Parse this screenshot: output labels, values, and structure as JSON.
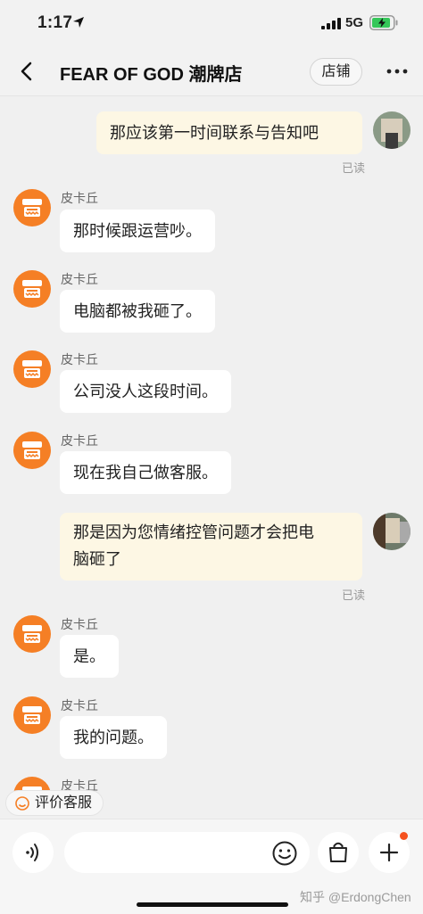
{
  "status": {
    "time": "1:17",
    "network": "5G"
  },
  "nav": {
    "title": "FEAR OF GOD 潮牌店",
    "shop_label": "店铺"
  },
  "messages": [
    {
      "dir": "out",
      "text": "那应该第一时间联系与告知吧",
      "read": "已读"
    },
    {
      "dir": "in",
      "sender": "皮卡丘",
      "text": "那时候跟运营吵。"
    },
    {
      "dir": "in",
      "sender": "皮卡丘",
      "text": "电脑都被我砸了。"
    },
    {
      "dir": "in",
      "sender": "皮卡丘",
      "text": "公司没人这段时间。"
    },
    {
      "dir": "in",
      "sender": "皮卡丘",
      "text": "现在我自己做客服。"
    },
    {
      "dir": "out",
      "text_line1": "那是因为您情绪控管问题才会把电",
      "text_line2": "脑砸了",
      "read": "已读"
    },
    {
      "dir": "in",
      "sender": "皮卡丘",
      "text": "是。"
    },
    {
      "dir": "in",
      "sender": "皮卡丘",
      "text": "我的问题。"
    },
    {
      "dir": "in",
      "sender": "皮卡丘"
    }
  ],
  "rate_label": "评价客服",
  "input": {
    "placeholder": ""
  },
  "watermark": "知乎 @ErdongChen",
  "colors": {
    "accent": "#f57f25",
    "out_bubble": "#fdf7e4",
    "in_bubble": "#ffffff",
    "badge": "#f5511e"
  }
}
